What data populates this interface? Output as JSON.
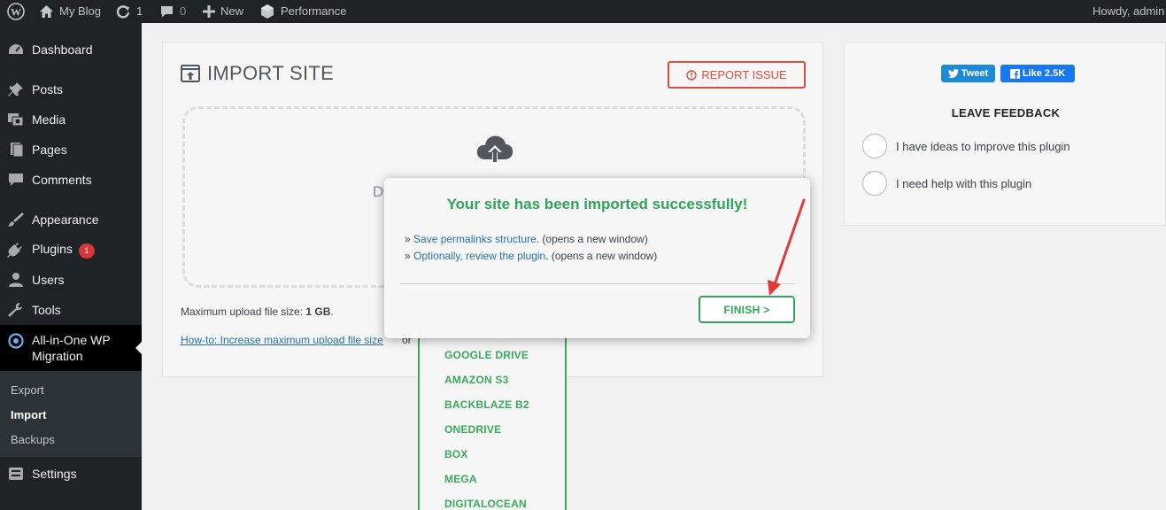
{
  "adminbar": {
    "site_name": "My Blog",
    "updates_count": "1",
    "comments_count": "0",
    "new_label": "New",
    "performance_label": "Performance",
    "greeting": "Howdy, admin"
  },
  "sidebar": {
    "items": [
      {
        "label": "Dashboard",
        "icon": "dashboard-icon"
      },
      {
        "label": "Posts",
        "icon": "pin-icon"
      },
      {
        "label": "Media",
        "icon": "media-icon"
      },
      {
        "label": "Pages",
        "icon": "pages-icon"
      },
      {
        "label": "Comments",
        "icon": "comment-icon"
      },
      {
        "label": "Appearance",
        "icon": "brush-icon"
      },
      {
        "label": "Plugins",
        "icon": "plug-icon",
        "badge": "1"
      },
      {
        "label": "Users",
        "icon": "users-icon"
      },
      {
        "label": "Tools",
        "icon": "wrench-icon"
      },
      {
        "label": "All-in-One WP Migration",
        "icon": "migration-icon"
      },
      {
        "label": "Settings",
        "icon": "settings-icon"
      }
    ],
    "submenu": [
      "Export",
      "Import",
      "Backups"
    ]
  },
  "import": {
    "title": "IMPORT SITE",
    "report_label": "REPORT ISSUE",
    "dropzone_text": "Dr",
    "upload_limit_label": "Maximum upload file size: ",
    "upload_limit_value": "1 GB",
    "upload_limit_suffix": ".",
    "howto_link": "How-to: Increase maximum upload file size",
    "howto_or": "or",
    "options": [
      "GOOGLE DRIVE",
      "AMAZON S3",
      "BACKBLAZE B2",
      "ONEDRIVE",
      "BOX",
      "MEGA",
      "DIGITALOCEAN"
    ]
  },
  "right_panel": {
    "tweet_label": "Tweet",
    "like_label": "Like 2.5K",
    "feedback_title": "LEAVE FEEDBACK",
    "options": [
      "I have ideas to improve this plugin",
      "I need help with this plugin"
    ]
  },
  "modal": {
    "title": "Your site has been imported successfully!",
    "lines": [
      {
        "prefix": "» ",
        "link": "Save permalinks structure",
        "suffix": ". (opens a new window)"
      },
      {
        "prefix": "» ",
        "link": "Optionally, review the plugin",
        "suffix": ". (opens a new window)"
      }
    ],
    "finish_label": "FINISH >"
  },
  "colors": {
    "accent_green": "#2fa55a",
    "report_red": "#d94f3f",
    "link_blue": "#2271b1",
    "admin_dark": "#1d2327",
    "annotation_red": "#e03a3a"
  }
}
